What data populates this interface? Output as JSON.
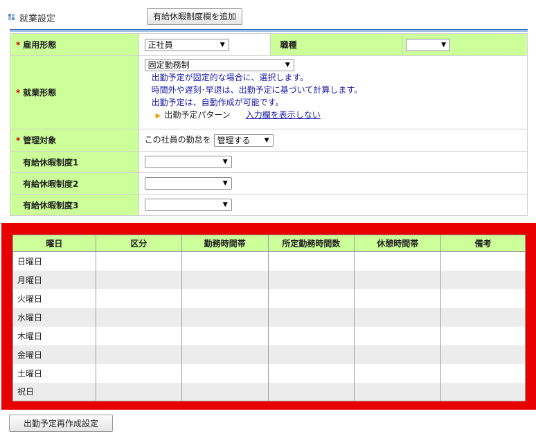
{
  "header": {
    "title": "就業設定",
    "add_button_label": "有給休暇制度欄を追加"
  },
  "form": {
    "employment_type": {
      "label": "雇用形態",
      "value": "正社員"
    },
    "job_type": {
      "label": "職種",
      "value": ""
    },
    "work_style": {
      "label": "就業形態",
      "value": "固定勤務制",
      "info_lines": [
        "出勤予定が固定的な場合に、選択します。",
        "時間外や遅刻･早退は、出勤予定に基づいて計算します。",
        "出勤予定は、自動作成が可能です。"
      ],
      "pattern_label": "出勤予定パターン",
      "pattern_link": "入力欄を表示しない"
    },
    "manage_target": {
      "label": "管理対象",
      "prefix": "この社員の勤怠を",
      "value": "管理する"
    },
    "paid_leave": [
      {
        "label": "有給休暇制度1",
        "value": ""
      },
      {
        "label": "有給休暇制度2",
        "value": ""
      },
      {
        "label": "有給休暇制度3",
        "value": ""
      }
    ],
    "required_mark": "*"
  },
  "schedule": {
    "columns": [
      "曜日",
      "区分",
      "勤務時間帯",
      "所定勤務時間数",
      "休憩時間帯",
      "備考"
    ],
    "rows": [
      "日曜日",
      "月曜日",
      "火曜日",
      "水曜日",
      "木曜日",
      "金曜日",
      "土曜日",
      "祝日"
    ]
  },
  "footer": {
    "recreate_button_label": "出勤予定再作成設定"
  },
  "colors": {
    "label_bg": "#ccff99",
    "highlight_frame": "#e60000",
    "info_text": "#1a1aa6",
    "rule": "#2d6fc4"
  }
}
